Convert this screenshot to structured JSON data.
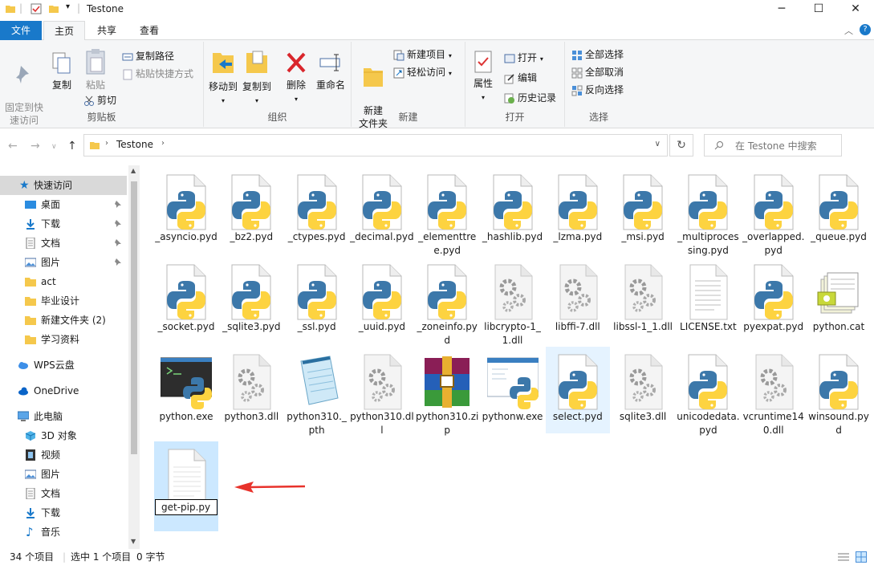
{
  "window": {
    "title": "Testone",
    "minimize": "─",
    "maximize": "☐",
    "close": "✕"
  },
  "tabs": {
    "file": "文件",
    "home": "主页",
    "share": "共享",
    "view": "查看"
  },
  "ribbon": {
    "clipboard": {
      "label": "剪贴板",
      "pin": "固定到快\n速访问",
      "copy": "复制",
      "paste": "粘贴",
      "copy_path": "复制路径",
      "paste_shortcut": "粘贴快捷方式",
      "cut": "剪切"
    },
    "organize": {
      "label": "组织",
      "move_to": "移动到",
      "copy_to": "复制到",
      "delete": "删除",
      "rename": "重命名"
    },
    "new": {
      "label": "新建",
      "new_folder": "新建\n文件夹",
      "new_item": "新建项目",
      "easy_access": "轻松访问"
    },
    "open": {
      "label": "打开",
      "properties": "属性",
      "open": "打开",
      "edit": "编辑",
      "history": "历史记录"
    },
    "select": {
      "label": "选择",
      "select_all": "全部选择",
      "select_none": "全部取消",
      "invert": "反向选择"
    }
  },
  "address": {
    "path": "Testone",
    "search_placeholder": "在 Testone 中搜索"
  },
  "sidebar": {
    "quick_access": "快速访问",
    "items": [
      "桌面",
      "下载",
      "文档",
      "图片",
      "act",
      "毕业设计",
      "新建文件夹 (2)",
      "学习资料"
    ],
    "wps": "WPS云盘",
    "onedrive": "OneDrive",
    "this_pc": "此电脑",
    "pc_items": [
      "3D 对象",
      "视频",
      "图片",
      "文档",
      "下载",
      "音乐"
    ]
  },
  "files": [
    {
      "name": "_asyncio.pyd",
      "icon": "python-file-icon"
    },
    {
      "name": "_bz2.pyd",
      "icon": "python-file-icon"
    },
    {
      "name": "_ctypes.pyd",
      "icon": "python-file-icon"
    },
    {
      "name": "_decimal.pyd",
      "icon": "python-file-icon"
    },
    {
      "name": "_elementtree.pyd",
      "icon": "python-file-icon"
    },
    {
      "name": "_hashlib.pyd",
      "icon": "python-file-icon"
    },
    {
      "name": "_lzma.pyd",
      "icon": "python-file-icon"
    },
    {
      "name": "_msi.pyd",
      "icon": "python-file-icon"
    },
    {
      "name": "_multiprocessing.pyd",
      "icon": "python-file-icon"
    },
    {
      "name": "_overlapped.pyd",
      "icon": "python-file-icon"
    },
    {
      "name": "_queue.pyd",
      "icon": "python-file-icon"
    },
    {
      "name": "_socket.pyd",
      "icon": "python-file-icon"
    },
    {
      "name": "_sqlite3.pyd",
      "icon": "python-file-icon"
    },
    {
      "name": "_ssl.pyd",
      "icon": "python-file-icon"
    },
    {
      "name": "_uuid.pyd",
      "icon": "python-file-icon"
    },
    {
      "name": "_zoneinfo.pyd",
      "icon": "python-file-icon"
    },
    {
      "name": "libcrypto-1_1.dll",
      "icon": "dll-gear-icon"
    },
    {
      "name": "libffi-7.dll",
      "icon": "dll-gear-icon"
    },
    {
      "name": "libssl-1_1.dll",
      "icon": "dll-gear-icon"
    },
    {
      "name": "LICENSE.txt",
      "icon": "text-file-icon"
    },
    {
      "name": "pyexpat.pyd",
      "icon": "python-file-icon"
    },
    {
      "name": "python.cat",
      "icon": "catalog-file-icon"
    },
    {
      "name": "python.exe",
      "icon": "python-exe-icon"
    },
    {
      "name": "python3.dll",
      "icon": "dll-gear-icon"
    },
    {
      "name": "python310._pth",
      "icon": "notepad-icon"
    },
    {
      "name": "python310.dll",
      "icon": "dll-gear-icon"
    },
    {
      "name": "python310.zip",
      "icon": "winrar-icon"
    },
    {
      "name": "pythonw.exe",
      "icon": "pythonw-exe-icon"
    },
    {
      "name": "select.pyd",
      "icon": "python-file-icon"
    },
    {
      "name": "sqlite3.dll",
      "icon": "dll-gear-icon"
    },
    {
      "name": "unicodedata.pyd",
      "icon": "python-file-icon"
    },
    {
      "name": "vcruntime140.dll",
      "icon": "dll-gear-icon"
    },
    {
      "name": "winsound.pyd",
      "icon": "python-file-icon"
    },
    {
      "name": "get-pip.py",
      "icon": "blank-file-icon"
    }
  ],
  "status": {
    "count": "34 个项目",
    "selected": "选中 1 个项目",
    "size": "0 字节"
  },
  "colors": {
    "accent": "#1979ca",
    "selection": "#cce8ff",
    "arrow": "#e8322b"
  }
}
